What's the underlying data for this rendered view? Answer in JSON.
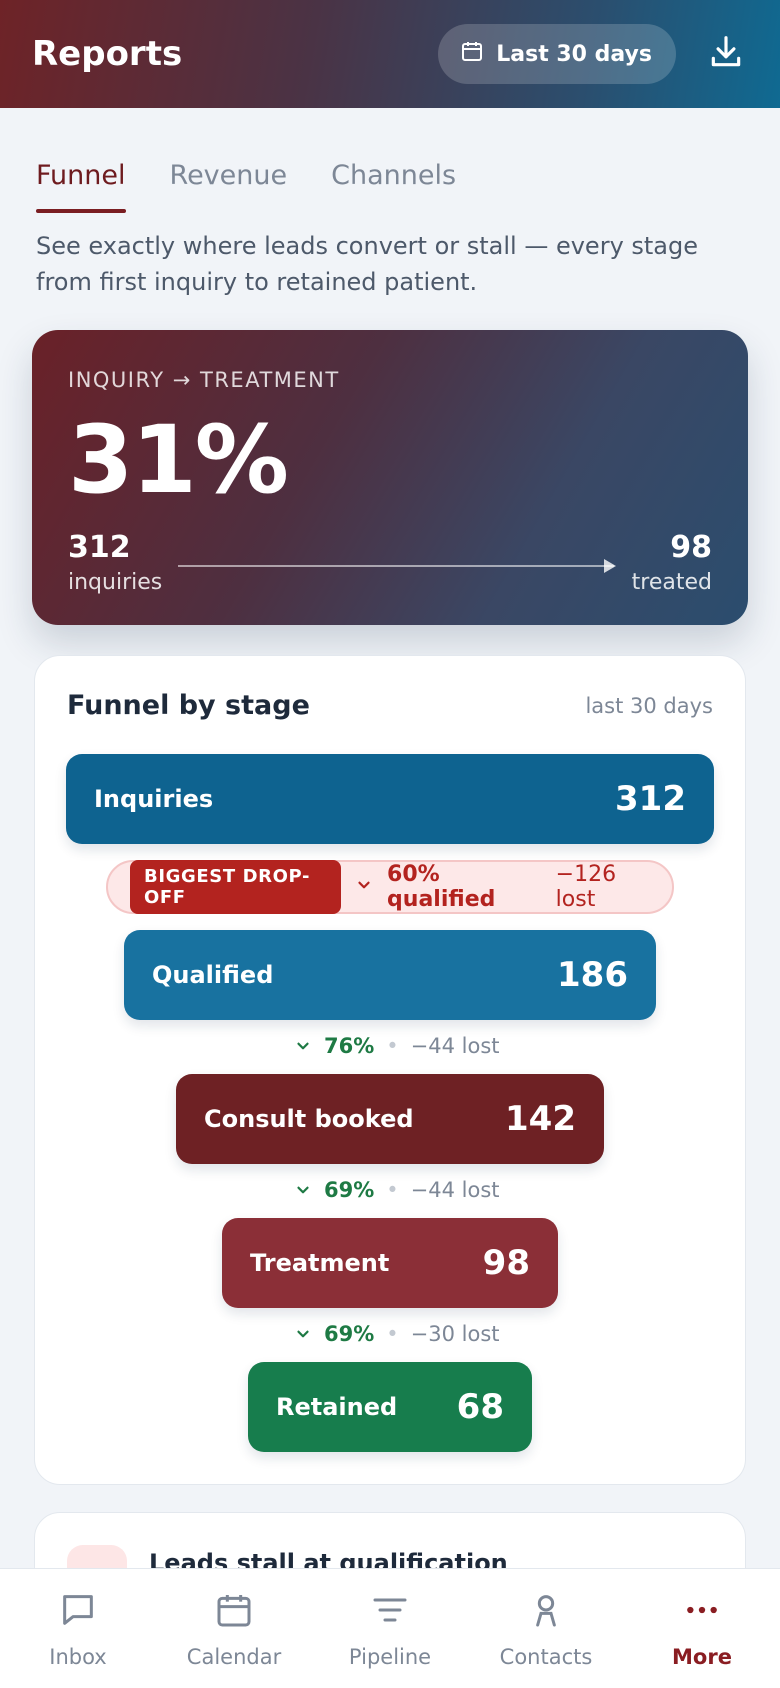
{
  "header": {
    "title": "Reports",
    "date_range": "Last 30 days",
    "calendar_icon": "calendar-icon",
    "download_icon": "download-icon"
  },
  "tabs": [
    {
      "label": "Funnel",
      "active": true
    },
    {
      "label": "Revenue",
      "active": false
    },
    {
      "label": "Channels",
      "active": false
    }
  ],
  "intro": "See exactly where leads convert or stall — every stage from first inquiry to retained patient.",
  "hero": {
    "label": "INQUIRY → TREATMENT",
    "value": "31%",
    "start_value": "312",
    "start_label": "inquiries",
    "end_value": "98",
    "end_label": "treated"
  },
  "funnel": {
    "title": "Funnel by stage",
    "meta": "last 30 days",
    "stages": [
      {
        "label": "Inquiries",
        "value": "312",
        "color": "#0e6390"
      },
      {
        "label": "Qualified",
        "value": "186",
        "color": "#1872a0"
      },
      {
        "label": "Consult booked",
        "value": "142",
        "color": "#6e2124"
      },
      {
        "label": "Treatment",
        "value": "98",
        "color": "#8b2f37"
      },
      {
        "label": "Retained",
        "value": "68",
        "color": "#177d4d"
      }
    ],
    "callout": {
      "badge": "BIGGEST DROP-OFF",
      "pct": "60% qualified",
      "lost": "−126 lost"
    },
    "drops": [
      {
        "pct": "76%",
        "lost": "−44 lost"
      },
      {
        "pct": "69%",
        "lost": "−44 lost"
      },
      {
        "pct": "69%",
        "lost": "−30 lost"
      }
    ]
  },
  "insight": {
    "title": "Leads stall at qualification"
  },
  "nav": [
    {
      "label": "Inbox",
      "icon": "inbox-icon",
      "active": false
    },
    {
      "label": "Calendar",
      "icon": "calendar-icon",
      "active": false
    },
    {
      "label": "Pipeline",
      "icon": "pipeline-icon",
      "active": false
    },
    {
      "label": "Contacts",
      "icon": "contacts-icon",
      "active": false
    },
    {
      "label": "More",
      "icon": "more-icon",
      "active": true
    }
  ],
  "colors": {
    "accent": "#7a1d22",
    "success": "#1e7a44",
    "danger": "#b3231f"
  }
}
